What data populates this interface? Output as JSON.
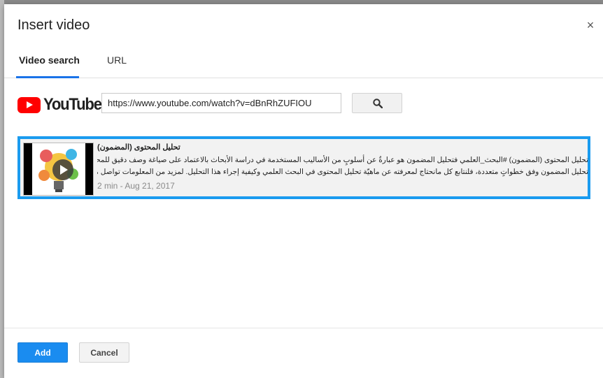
{
  "dialog": {
    "title": "Insert video",
    "close_glyph": "×"
  },
  "tabs": [
    {
      "label": "Video search",
      "active": true
    },
    {
      "label": "URL",
      "active": false
    }
  ],
  "search": {
    "logo_text": "YouTube",
    "query": "https://www.youtube.com/watch?v=dBnRhZUFIOU",
    "button_icon": "search-icon"
  },
  "results": [
    {
      "title": "تحليل المحتوى (المضمون)",
      "description_lines": [
        "تحليل المحتوى (المضمون) #البحث_العلمي فتحليل المضمون هو عبارةٌ عن أسلوبٍ من الأساليب المستخدمة في دراسة الأبحاث بالاعتماد على صياغة وصف دقيق للمحتوى البحثي. ويسير",
        "تحليل المضمون وفق خطواتٍ متعددة، فلنتابع كل مانحتاج لمعرفته عن ماهيّة تحليل المحتوى في البحث العلمي وكيفية إجراء هذا التحليل. لمزيد من المعلومات تواصل من خلال : الموقع"
      ],
      "meta": "2 min - Aug 21, 2017"
    }
  ],
  "footer": {
    "add_label": "Add",
    "cancel_label": "Cancel"
  },
  "colors": {
    "accent": "#1a73e8",
    "selection_border": "#1a9bef",
    "youtube_red": "#ff0000",
    "add_button": "#1a8cf0"
  }
}
